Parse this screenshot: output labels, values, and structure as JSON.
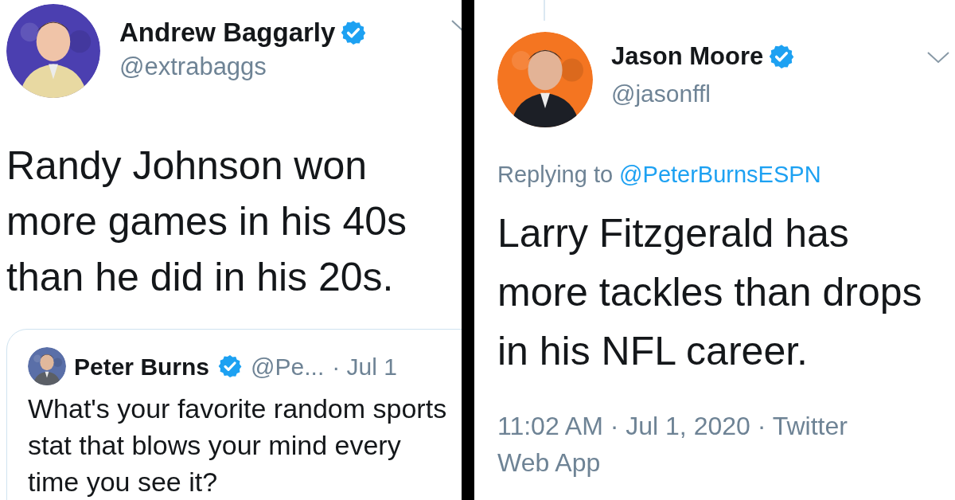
{
  "tweets": [
    {
      "kind": "quote",
      "author": {
        "name": "Andrew Baggarly",
        "handle": "@extrabaggs",
        "verified": true
      },
      "text": "Randy Johnson won more games in his 40s than he did in his 20s.",
      "quoted": {
        "author": {
          "name": "Peter Burns",
          "handle": "@Pe...",
          "verified": true
        },
        "date": "· Jul 1",
        "text": "What's your favorite random sports stat that blows your mind every time you see it?"
      }
    },
    {
      "kind": "reply",
      "author": {
        "name": "Jason Moore",
        "handle": "@jasonffl",
        "verified": true
      },
      "replying_to": {
        "label": "Replying to",
        "handle": "@PeterBurnsESPN"
      },
      "text": "Larry Fitzgerald has more tackles than drops in his NFL career.",
      "footer": "11:02 AM · Jul 1, 2020 · Twitter Web App"
    }
  ]
}
